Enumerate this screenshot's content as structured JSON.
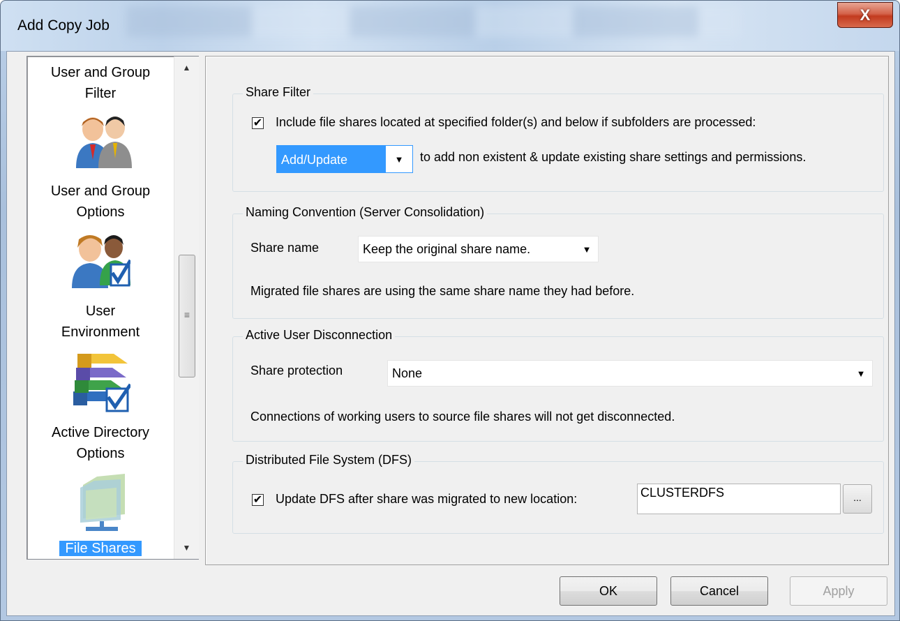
{
  "window": {
    "title": "Add Copy Job",
    "close_glyph": "X"
  },
  "nav": {
    "items": [
      {
        "label_line1": "User and Group",
        "label_line2": "Filter",
        "icon": "users-icon"
      },
      {
        "label_line1": "User and Group",
        "label_line2": "Options",
        "icon": "user-check-icon"
      },
      {
        "label_line1": "User",
        "label_line2": "Environment",
        "icon": "books-check-icon"
      },
      {
        "label_line1": "Active Directory",
        "label_line2": "Options",
        "icon": "folder-share-icon"
      },
      {
        "label_line1": "File Shares",
        "label_line2": "",
        "selected": true
      }
    ],
    "scroll_up": "▲",
    "scroll_down": "▼",
    "scroll_grip": "≡"
  },
  "share_filter": {
    "legend": "Share Filter",
    "checkbox_checked": true,
    "checkbox_label": "Include file shares located at specified folder(s) and below if subfolders are processed:",
    "mode_value": "Add/Update",
    "mode_description": "to add non existent & update existing share settings and permissions."
  },
  "naming": {
    "legend": "Naming Convention (Server Consolidation)",
    "share_name_label": "Share name",
    "share_name_value": "Keep the original share name.",
    "description": "Migrated file shares are using the same share name they had before."
  },
  "disconnection": {
    "legend": "Active User Disconnection",
    "protection_label": "Share protection",
    "protection_value": "None",
    "description": "Connections of working users to source file shares will not get disconnected."
  },
  "dfs": {
    "legend": "Distributed File System (DFS)",
    "checkbox_checked": true,
    "checkbox_label": "Update DFS after share was migrated to new location:",
    "location_value": "CLUSTERDFS",
    "browse_label": "..."
  },
  "buttons": {
    "ok": "OK",
    "cancel": "Cancel",
    "apply": "Apply"
  },
  "dropdown_arrow": "▼",
  "check_glyph": "✔"
}
